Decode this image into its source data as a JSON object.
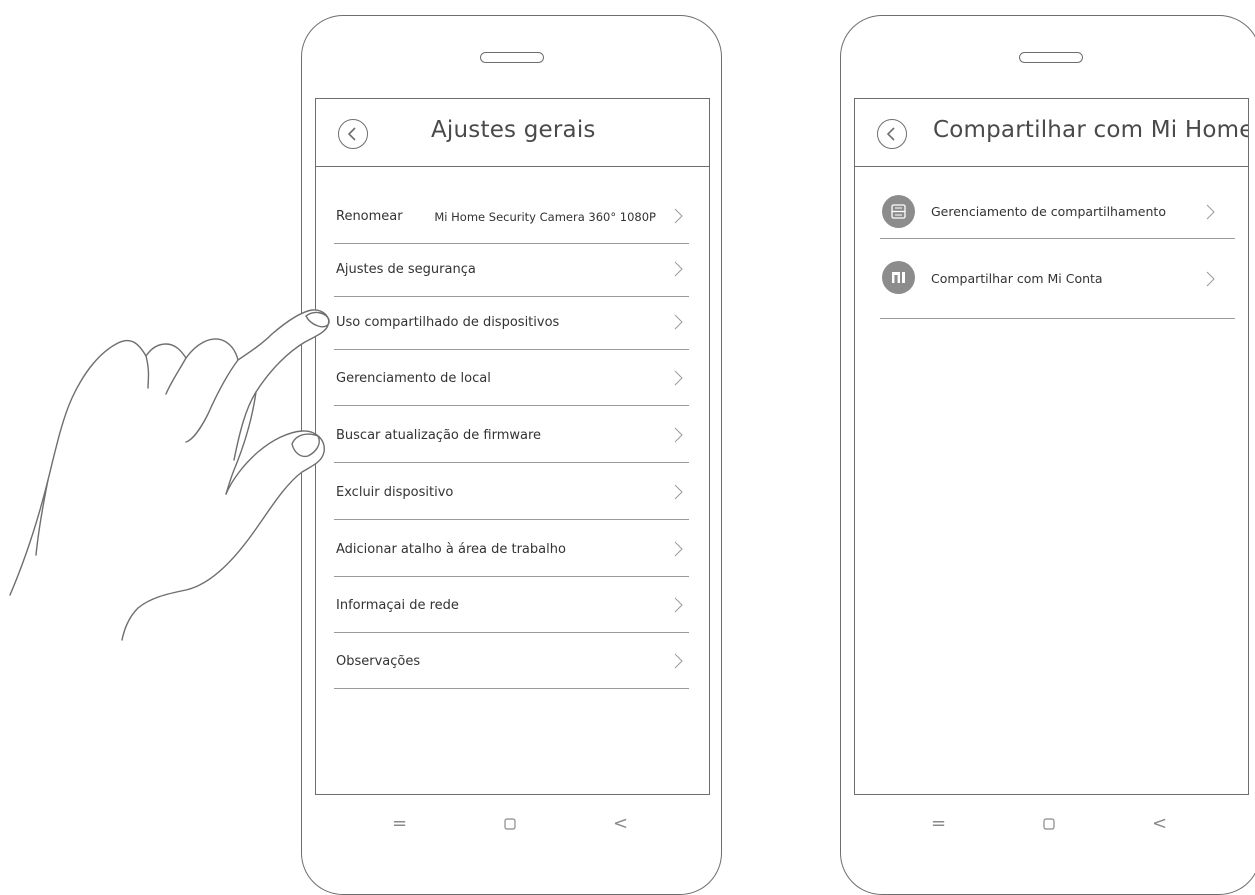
{
  "left_screen": {
    "title": "Ajustes gerais",
    "rows": [
      {
        "label": "Renomear",
        "value": "Mi Home Security Camera 360° 1080P"
      },
      {
        "label": "Ajustes de segurança",
        "value": ""
      },
      {
        "label": "Uso compartilhado de dispositivos",
        "value": ""
      },
      {
        "label": "Gerenciamento de local",
        "value": ""
      },
      {
        "label": "Buscar atualização de firmware",
        "value": ""
      },
      {
        "label": "Excluir dispositivo",
        "value": ""
      },
      {
        "label": "Adicionar atalho à área de trabalho",
        "value": ""
      },
      {
        "label": "Informaçai de rede",
        "value": ""
      },
      {
        "label": "Observações",
        "value": ""
      }
    ]
  },
  "right_screen": {
    "title": "Compartilhar com Mi Home...",
    "rows": [
      {
        "label": "Gerenciamento de compartilhamento",
        "icon": "share-manage-icon"
      },
      {
        "label": "Compartilhar com Mi Conta",
        "icon": "mi-logo-icon"
      }
    ]
  },
  "navbar": {
    "menu_glyph": "=",
    "back_glyph": "<"
  },
  "colors": {
    "outline": "#6e6e6e",
    "divider": "#9a9a9a",
    "icon_fill": "#8c8c8c",
    "text": "#333333"
  }
}
